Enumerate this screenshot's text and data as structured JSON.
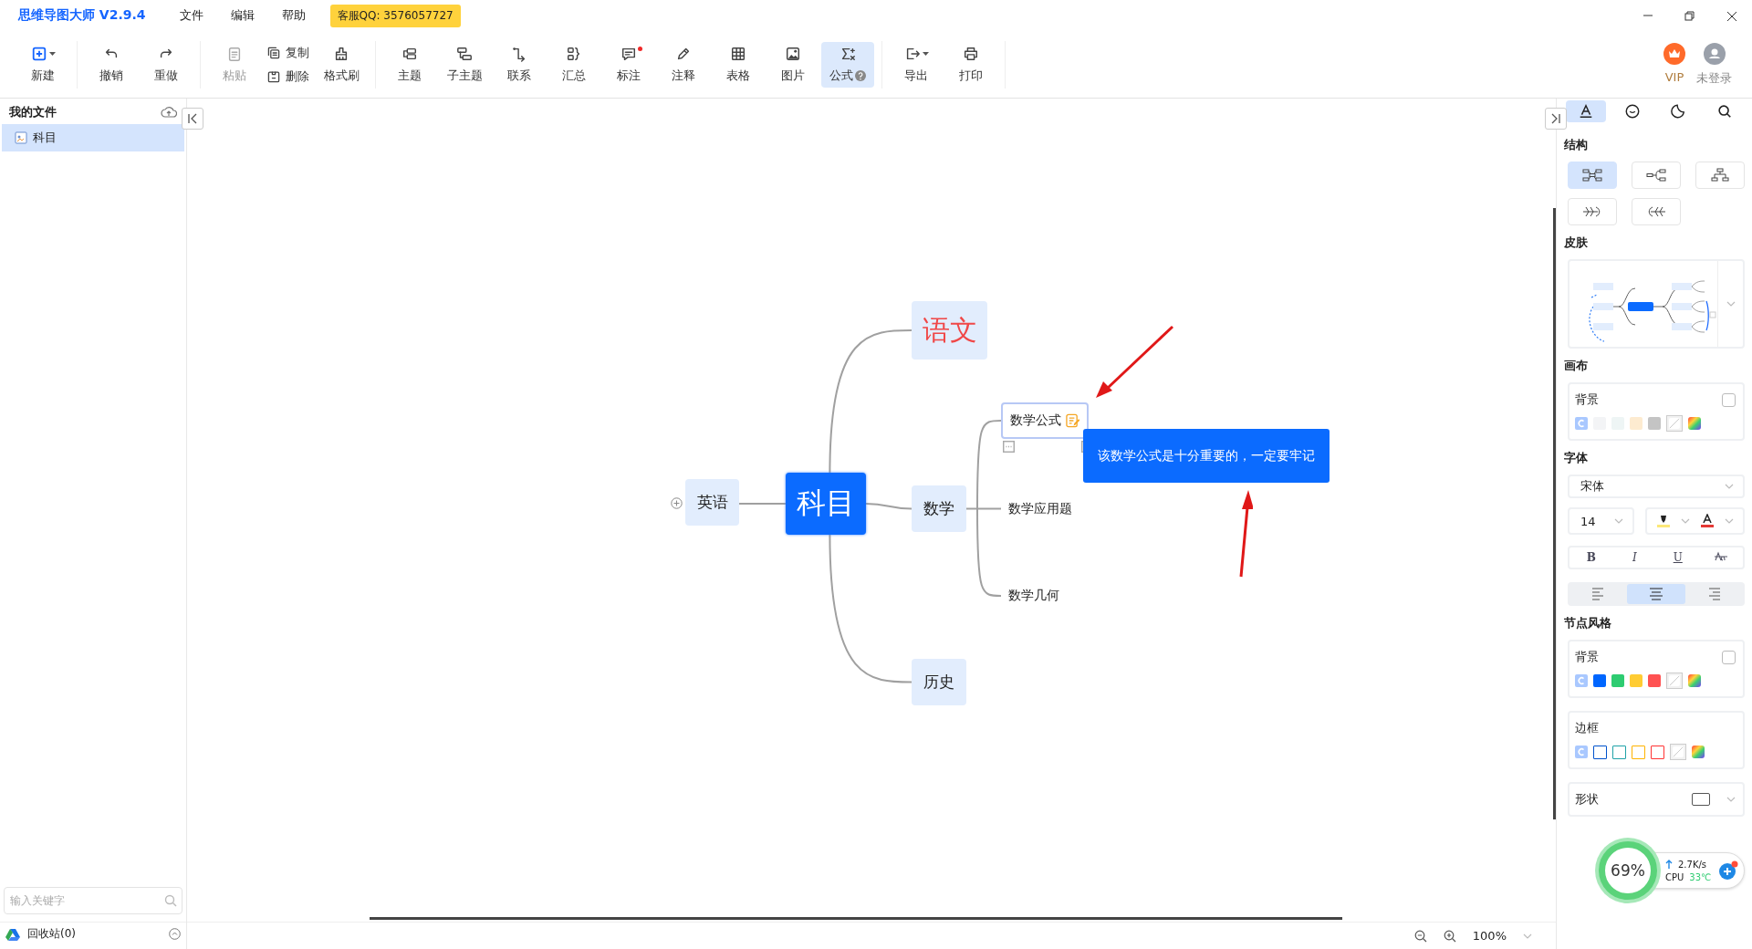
{
  "app_title": "思维导图大师 V2.9.4",
  "menu": [
    {
      "label": "文件"
    },
    {
      "label": "编辑"
    },
    {
      "label": "帮助"
    }
  ],
  "support_badge": "客服QQ: 3576057727",
  "toolbar": [
    {
      "items": [
        {
          "label": "新建",
          "kind": "big",
          "disabled": false,
          "selected": false,
          "dropdown": true,
          "dot": false,
          "help": false
        }
      ]
    },
    {
      "items": [
        {
          "label": "撤销",
          "kind": "big",
          "disabled": false,
          "selected": false,
          "dropdown": false,
          "dot": false,
          "help": false
        },
        {
          "label": "重做",
          "kind": "big",
          "disabled": false,
          "selected": false,
          "dropdown": false,
          "dot": false,
          "help": false
        }
      ]
    },
    {
      "items": [
        {
          "label": "粘贴",
          "kind": "big",
          "disabled": true,
          "selected": false,
          "dropdown": false,
          "dot": false,
          "help": false
        },
        {
          "label": "复制",
          "kind": "small",
          "disabled": false,
          "selected": false,
          "dropdown": false,
          "dot": false,
          "help": false
        },
        {
          "label": "删除",
          "kind": "small",
          "disabled": false,
          "selected": false,
          "dropdown": false,
          "dot": false,
          "help": false
        },
        {
          "label": "格式刷",
          "kind": "big",
          "disabled": false,
          "selected": false,
          "dropdown": false,
          "dot": false,
          "help": false
        }
      ]
    },
    {
      "items": [
        {
          "label": "主题",
          "kind": "big",
          "disabled": false,
          "selected": false,
          "dropdown": false,
          "dot": false,
          "help": false
        },
        {
          "label": "子主题",
          "kind": "big",
          "disabled": false,
          "selected": false,
          "dropdown": false,
          "dot": false,
          "help": false
        },
        {
          "label": "联系",
          "kind": "big",
          "disabled": false,
          "selected": false,
          "dropdown": false,
          "dot": false,
          "help": false
        },
        {
          "label": "汇总",
          "kind": "big",
          "disabled": false,
          "selected": false,
          "dropdown": false,
          "dot": false,
          "help": false
        },
        {
          "label": "标注",
          "kind": "big",
          "disabled": false,
          "selected": false,
          "dropdown": false,
          "dot": true,
          "help": false
        },
        {
          "label": "注释",
          "kind": "big",
          "disabled": false,
          "selected": false,
          "dropdown": false,
          "dot": false,
          "help": false
        },
        {
          "label": "表格",
          "kind": "big",
          "disabled": false,
          "selected": false,
          "dropdown": false,
          "dot": false,
          "help": false
        },
        {
          "label": "图片",
          "kind": "big",
          "disabled": false,
          "selected": false,
          "dropdown": false,
          "dot": false,
          "help": false
        },
        {
          "label": "公式",
          "kind": "big",
          "disabled": false,
          "selected": true,
          "dropdown": false,
          "dot": false,
          "help": true
        }
      ]
    },
    {
      "items": [
        {
          "label": "导出",
          "kind": "big",
          "disabled": false,
          "selected": false,
          "dropdown": true,
          "dot": false,
          "help": false
        },
        {
          "label": "打印",
          "kind": "big",
          "disabled": false,
          "selected": false,
          "dropdown": false,
          "dot": false,
          "help": false
        }
      ]
    }
  ],
  "account": [
    {
      "label": "VIP",
      "kind": "vip"
    },
    {
      "label": "未登录",
      "kind": "user"
    }
  ],
  "sidebar": {
    "title": "我的文件",
    "files": [
      {
        "name": "科目",
        "selected": true
      }
    ],
    "search": {
      "placeholder": "输入关键字"
    },
    "recycle": "回收站(0)"
  },
  "mindmap": {
    "center": {
      "text": "科目",
      "selected": false
    },
    "topics": [
      {
        "text": "语文",
        "color": "#f04848"
      },
      {
        "text": "英语",
        "color": "#222222",
        "collapsed": true
      },
      {
        "text": "数学",
        "color": "#222222",
        "children": [
          {
            "text": "数学公式",
            "selected": true,
            "note": "该数学公式是十分重要的，一定要牢记"
          },
          {
            "text": "数学应用题",
            "selected": false
          },
          {
            "text": "数学几何",
            "selected": false
          }
        ]
      },
      {
        "text": "历史",
        "color": "#222222"
      }
    ]
  },
  "zoom": "100%",
  "panel": {
    "tabs": [
      {
        "selected": true
      },
      {
        "selected": false
      },
      {
        "selected": false
      },
      {
        "selected": false
      }
    ],
    "structure": {
      "title": "结构",
      "options": [
        {
          "selected": true
        },
        {
          "selected": false
        },
        {
          "selected": false
        },
        {
          "selected": false
        },
        {
          "selected": false
        }
      ]
    },
    "skin": {
      "title": "皮肤"
    },
    "canvas": {
      "title": "画布",
      "background": {
        "label": "背景",
        "checked": false,
        "swatches": [
          {
            "kind": "auto"
          },
          {
            "kind": "color",
            "color": "#f3f4f6"
          },
          {
            "kind": "color",
            "color": "#eef5f5"
          },
          {
            "kind": "color",
            "color": "#fdebd0"
          },
          {
            "kind": "color",
            "color": "#c4c4c4"
          },
          {
            "kind": "none"
          },
          {
            "kind": "custom"
          }
        ]
      }
    },
    "font": {
      "title": "字体",
      "family": "宋体",
      "size": "14",
      "color_tools": [
        {
          "kind": "highlight",
          "color": "#fce878"
        },
        {
          "kind": "text",
          "color": "#e53935"
        }
      ],
      "styles": [
        {
          "kind": "bold",
          "label": "B",
          "selected": false
        },
        {
          "kind": "italic",
          "label": "I",
          "selected": false
        },
        {
          "kind": "underline",
          "label": "U",
          "selected": false
        },
        {
          "kind": "strike",
          "selected": false
        }
      ],
      "align": [
        {
          "selected": false
        },
        {
          "selected": true
        },
        {
          "selected": false
        }
      ]
    },
    "node_style": {
      "title": "节点风格",
      "background": {
        "label": "背景",
        "checked": false,
        "swatches": [
          {
            "kind": "auto"
          },
          {
            "kind": "color",
            "color": "#0066ff"
          },
          {
            "kind": "color",
            "color": "#2ecc71"
          },
          {
            "kind": "color",
            "color": "#ffcc33"
          },
          {
            "kind": "color",
            "color": "#ff5252"
          },
          {
            "kind": "none"
          },
          {
            "kind": "custom"
          }
        ]
      },
      "border": {
        "label": "边框",
        "swatches": [
          {
            "kind": "auto"
          },
          {
            "kind": "border",
            "color": "#0052cc"
          },
          {
            "kind": "border",
            "color": "#1fa2a8"
          },
          {
            "kind": "border",
            "color": "#ffb300"
          },
          {
            "kind": "border",
            "color": "#ff3333"
          },
          {
            "kind": "none"
          },
          {
            "kind": "custom"
          }
        ]
      },
      "shape": {
        "label": "形状"
      }
    }
  },
  "monitor": {
    "percent": "69%",
    "speed": "2.7K/s",
    "cpu_label": "CPU",
    "temp": "33℃"
  }
}
